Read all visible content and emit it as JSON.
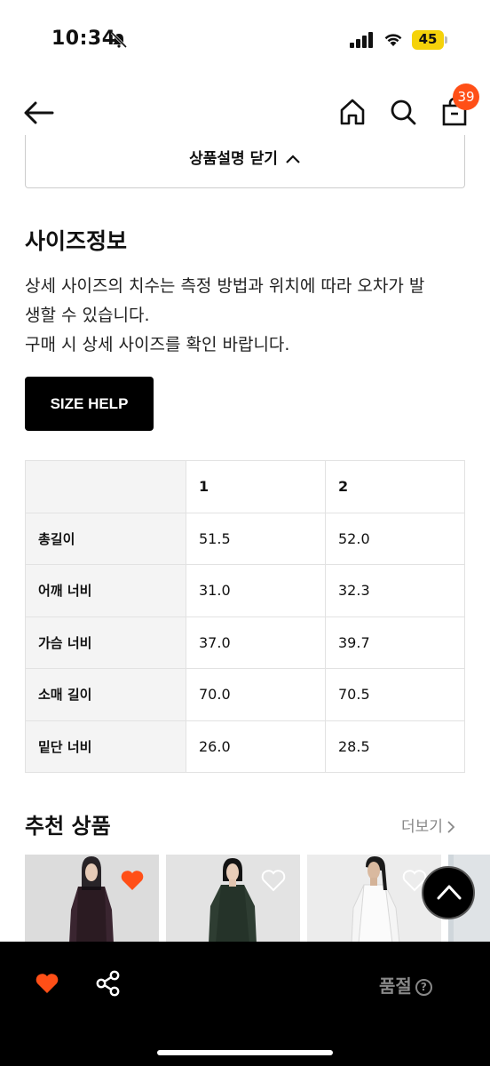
{
  "status_bar": {
    "time": "10:34",
    "battery": "45"
  },
  "nav": {
    "cart_count": "39"
  },
  "collapse": {
    "label": "상품설명 닫기"
  },
  "size_info": {
    "title": "사이즈정보",
    "description_line1": "상세 사이즈의 치수는 측정 방법과 위치에 따라 오차가 발",
    "description_line2": "생할 수 있습니다.",
    "description_line3": "구매 시 상세 사이즈를 확인 바랍니다.",
    "help_button": "SIZE HELP",
    "columns": [
      "1",
      "2"
    ],
    "rows": [
      {
        "label": "총길이",
        "values": [
          "51.5",
          "52.0"
        ]
      },
      {
        "label": "어깨 너비",
        "values": [
          "31.0",
          "32.3"
        ]
      },
      {
        "label": "가슴 너비",
        "values": [
          "37.0",
          "39.7"
        ]
      },
      {
        "label": "소매 길이",
        "values": [
          "70.0",
          "70.5"
        ]
      },
      {
        "label": "밑단 너비",
        "values": [
          "26.0",
          "28.5"
        ]
      }
    ]
  },
  "recommend": {
    "title": "추천 상품",
    "more_label": "더보기"
  },
  "bottom_bar": {
    "status_label": "품절",
    "help_glyph": "?"
  },
  "colors": {
    "accent": "#ff4f17",
    "black": "#000000",
    "muted": "#888888"
  }
}
